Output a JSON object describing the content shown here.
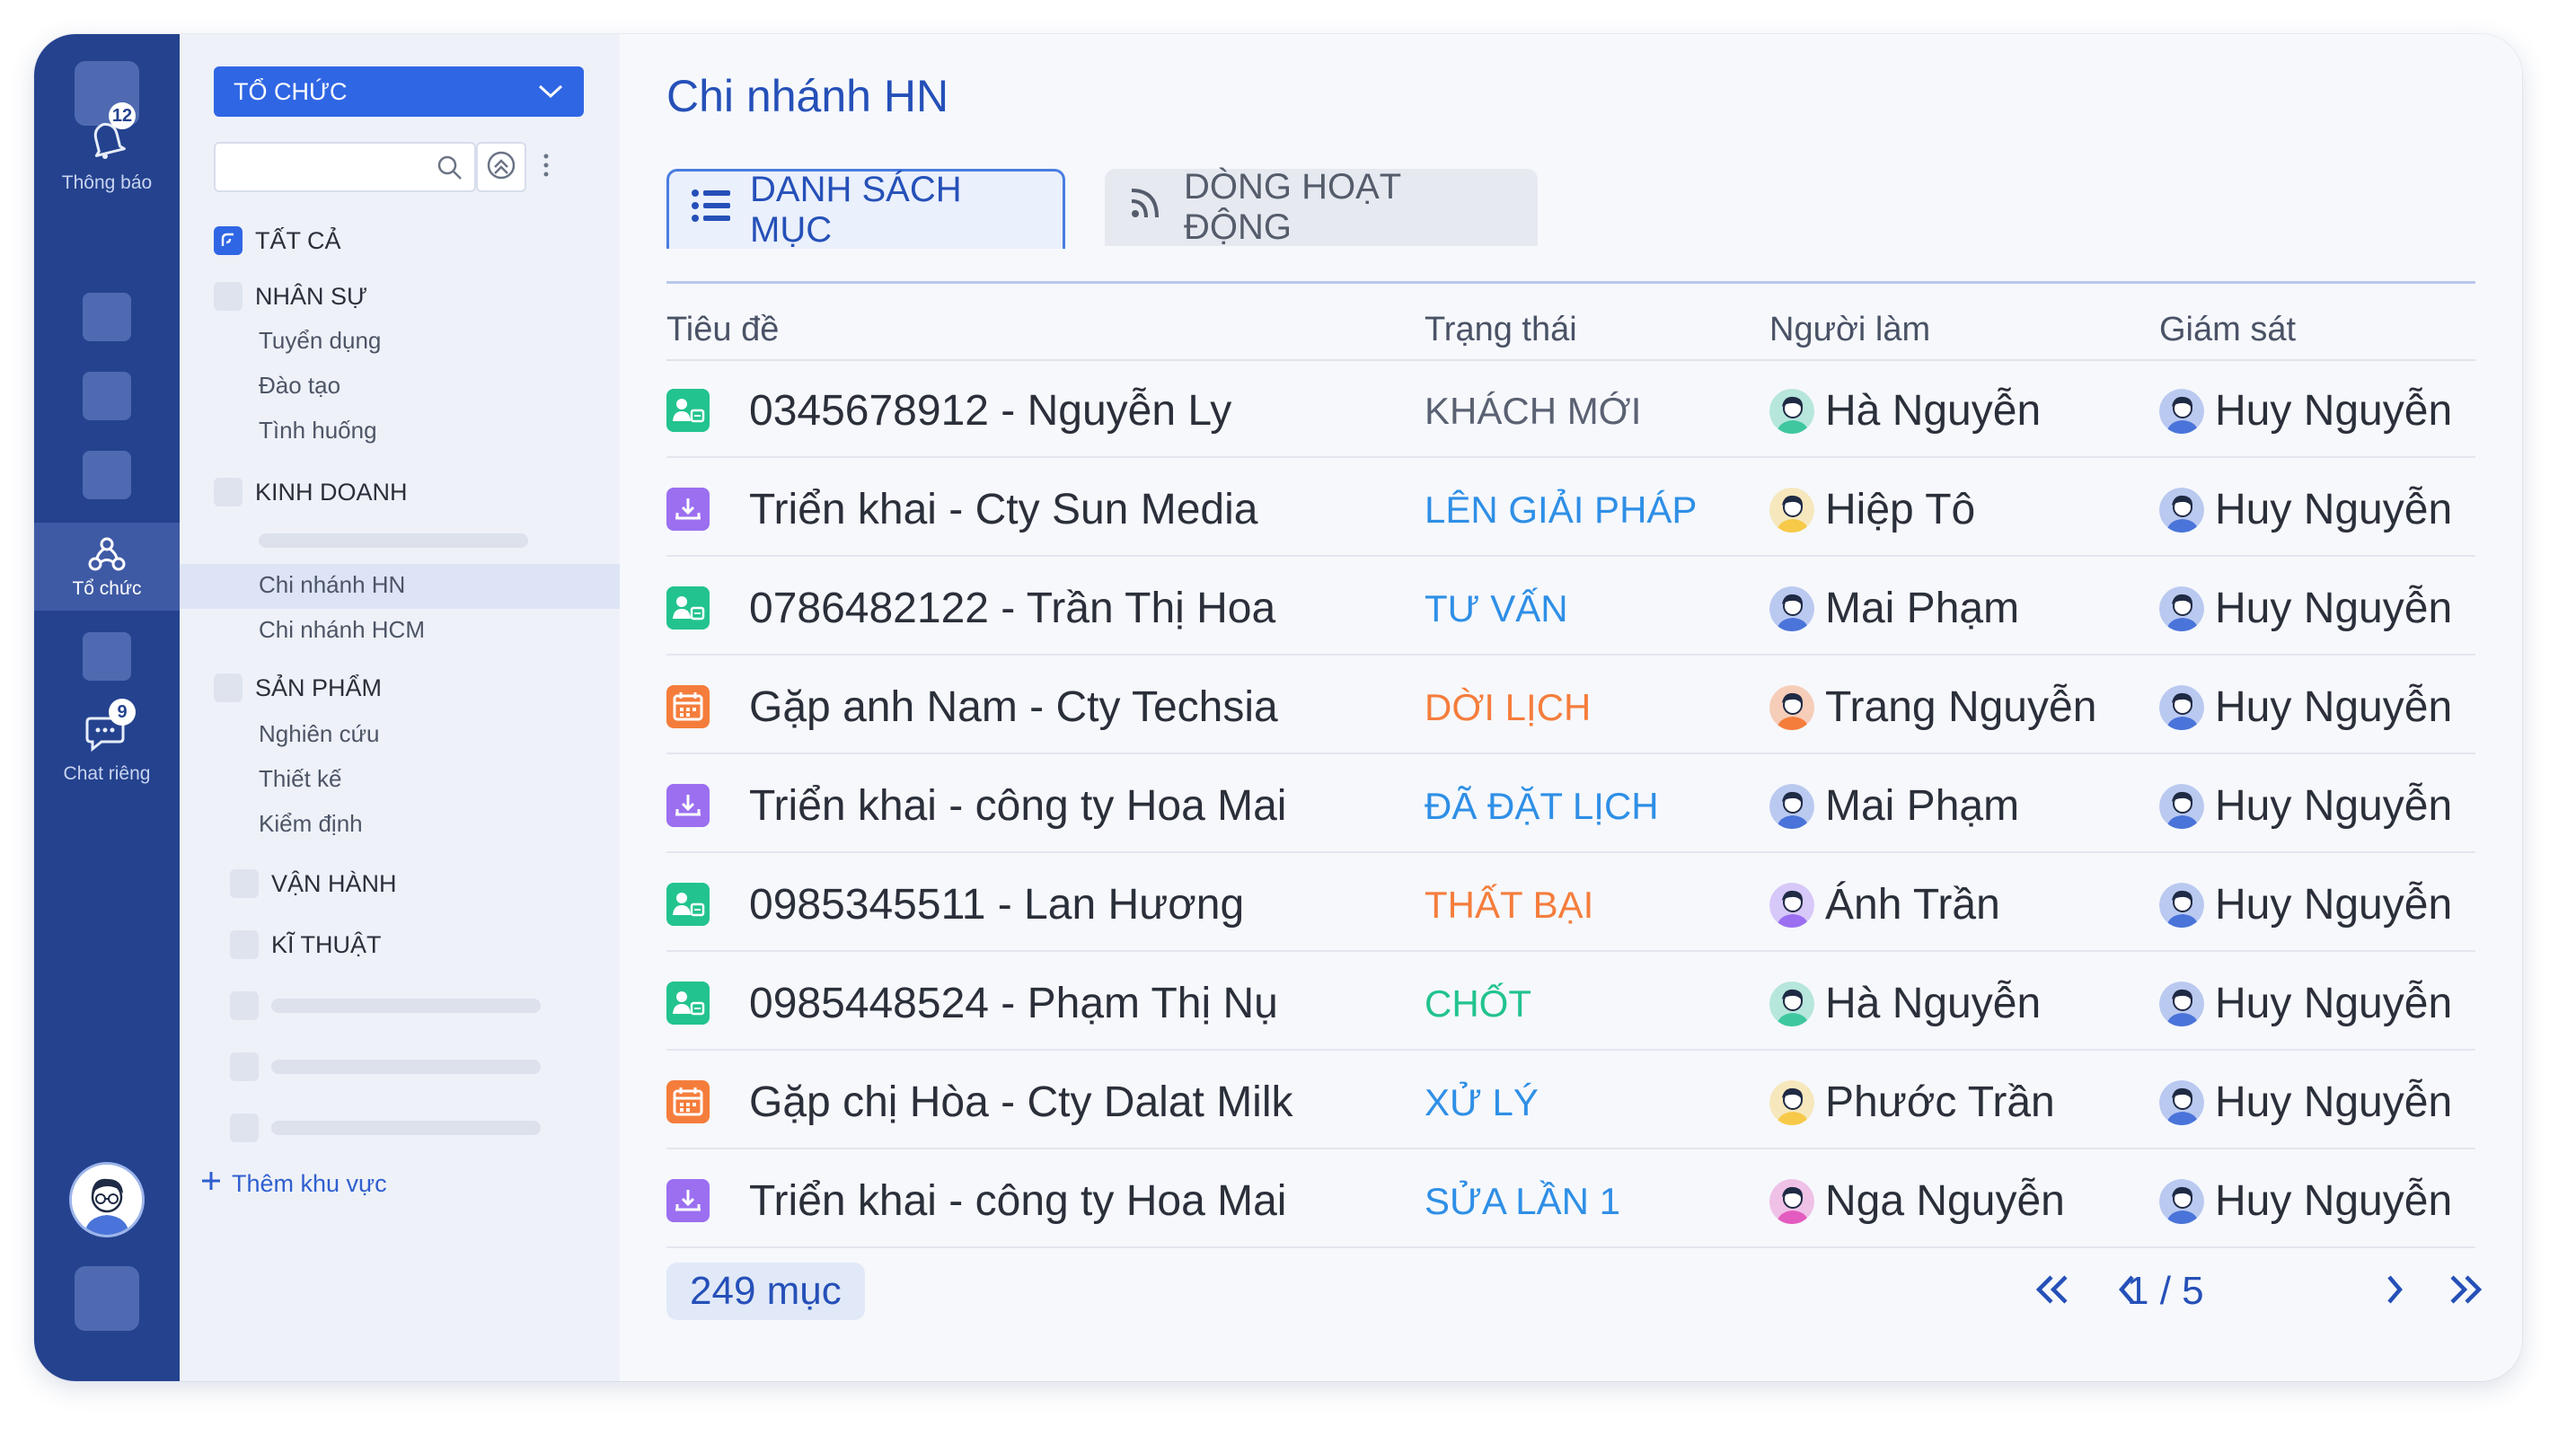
{
  "rail": {
    "notifications": {
      "label": "Thông báo",
      "badge": "12"
    },
    "organization": {
      "label": "Tổ chức"
    },
    "private_chat": {
      "label": "Chat riêng",
      "badge": "9"
    }
  },
  "sidebar": {
    "org_select": "TỔ CHỨC",
    "search": {
      "placeholder": ""
    },
    "all_label": "TẤT CẢ",
    "groups": {
      "hr": {
        "label": "NHÂN SỰ",
        "children": [
          "Tuyển dụng",
          "Đào tạo",
          "Tình huống"
        ]
      },
      "sales": {
        "label": "KINH DOANH",
        "children": [
          "Chi nhánh HN",
          "Chi nhánh HCM"
        ]
      },
      "product": {
        "label": "SẢN PHẨM",
        "children": [
          "Nghiên cứu",
          "Thiết kế",
          "Kiểm định"
        ]
      },
      "operations": {
        "label": "VẬN HÀNH"
      },
      "technical": {
        "label": "KĨ THUẬT"
      }
    },
    "add_area": "Thêm khu vực"
  },
  "main": {
    "title": "Chi nhánh HN",
    "tabs": [
      {
        "label": "DANH SÁCH MỤC",
        "active": true
      },
      {
        "label": "DÒNG HOẠT ĐỘNG",
        "active": false
      }
    ],
    "columns": [
      "Tiêu đề",
      "Trạng thái",
      "Người làm",
      "Giám sát"
    ],
    "rows": [
      {
        "icon": "customer-icon",
        "title": "0345678912 - Nguyễn Ly",
        "status": "KHÁCH MỚI",
        "status_color": "#5a6172",
        "doer": "Hà Nguyễn",
        "supervisor": "Huy Nguyễn"
      },
      {
        "icon": "deploy-icon",
        "title": "Triển khai - Cty Sun Media",
        "status": "LÊN GIẢI PHÁP",
        "status_color": "#2f8fe6",
        "doer": "Hiệp Tô",
        "supervisor": "Huy Nguyễn"
      },
      {
        "icon": "customer-icon",
        "title": "0786482122 - Trần Thị Hoa",
        "status": "TƯ VẤN",
        "status_color": "#2f8fe6",
        "doer": "Mai Phạm",
        "supervisor": "Huy Nguyễn"
      },
      {
        "icon": "calendar-icon",
        "title": "Gặp anh Nam - Cty Techsia",
        "status": "DỜI LỊCH",
        "status_color": "#f57d3c",
        "doer": "Trang Nguyễn",
        "supervisor": "Huy Nguyễn"
      },
      {
        "icon": "deploy-icon",
        "title": "Triển khai - công ty Hoa Mai",
        "status": "ĐÃ ĐẶT LỊCH",
        "status_color": "#2f8fe6",
        "doer": "Mai Phạm",
        "supervisor": "Huy Nguyễn"
      },
      {
        "icon": "customer-icon",
        "title": "0985345511 - Lan Hương",
        "status": "THẤT BẠI",
        "status_color": "#f57d3c",
        "doer": "Ánh Trần",
        "supervisor": "Huy Nguyễn"
      },
      {
        "icon": "customer-icon",
        "title": "0985448524 - Phạm Thị Nụ",
        "status": "CHỐT",
        "status_color": "#22c38e",
        "doer": "Hà Nguyễn",
        "supervisor": "Huy Nguyễn"
      },
      {
        "icon": "calendar-icon",
        "title": "Gặp chị Hòa - Cty Dalat Milk",
        "status": "XỬ LÝ",
        "status_color": "#2f8fe6",
        "doer": "Phước Trần",
        "supervisor": "Huy Nguyễn"
      },
      {
        "icon": "deploy-icon",
        "title": "Triển khai - công ty Hoa Mai",
        "status": "SỬA LẦN 1",
        "status_color": "#2f8fe6",
        "doer": "Nga Nguyễn",
        "supervisor": "Huy Nguyễn"
      }
    ],
    "count": "249 mục",
    "page_indicator": "1 / 5"
  },
  "colors": {
    "rail": "#24428e",
    "accent": "#2f66e4",
    "customer_icon": "#22c38e",
    "deploy_icon": "#9b6ff0",
    "calendar_icon": "#f57d3c"
  }
}
